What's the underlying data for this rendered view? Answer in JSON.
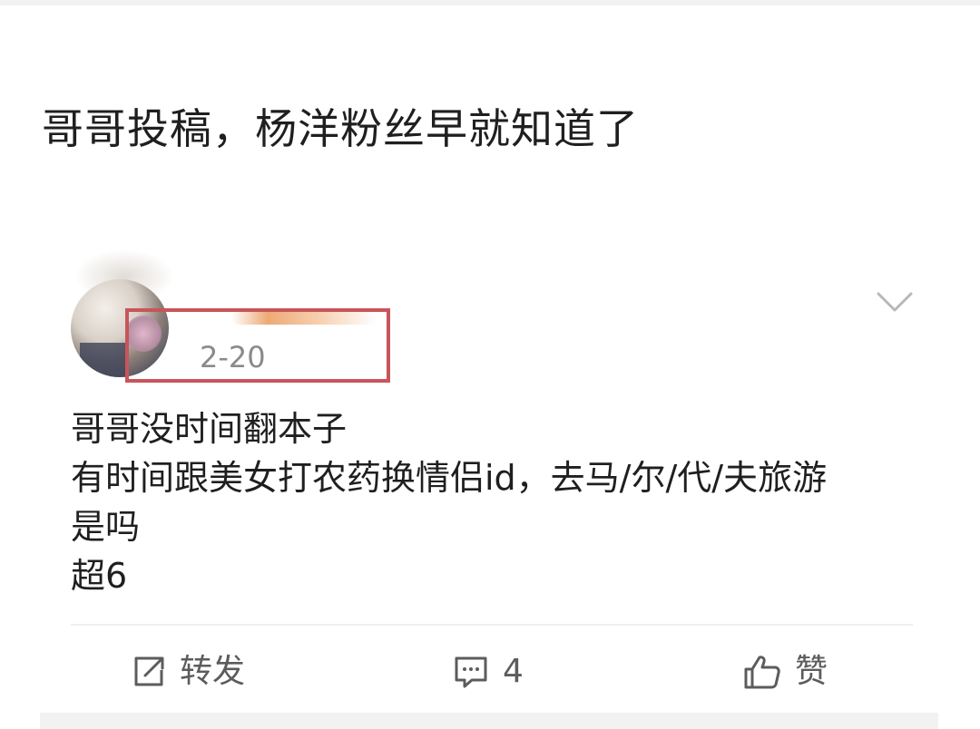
{
  "headline": "哥哥投稿，杨洋粉丝早就知道了",
  "post": {
    "date": "2-20",
    "body_lines": [
      "哥哥没时间翻本子",
      "有时间跟美女打农药换情侣id，去马/尔/代/夫旅游",
      "是吗",
      "超6"
    ]
  },
  "actions": {
    "repost_label": "转发",
    "comment_count": "4",
    "like_label": "赞"
  },
  "colors": {
    "highlight_border": "#c8555a",
    "meta_text": "#8a8a8a",
    "action_text": "#5c5c5c"
  },
  "icons": {
    "repost": "share-icon",
    "comment": "comment-icon",
    "like": "thumbs-up-icon",
    "menu": "chevron-down-icon"
  }
}
